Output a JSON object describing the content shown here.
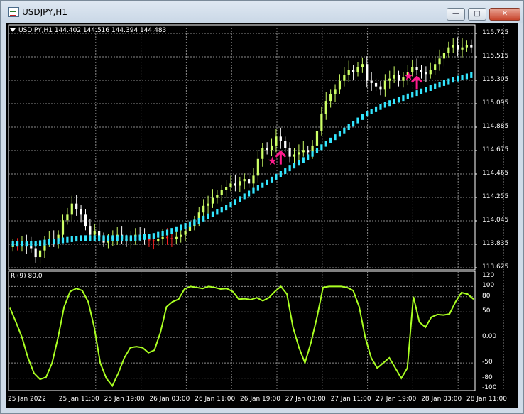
{
  "window": {
    "title": "USDJPY,H1",
    "controls": {
      "minimize": "—",
      "maximize": "□",
      "close": "✕"
    }
  },
  "chart": {
    "symbol_line": "USDJPY,H1  144.402 144.516 144.394 144.483",
    "indicator_label": "RI(9) 80.0",
    "colors": {
      "background": "#000000",
      "grid": "#8a8a8a",
      "bull": "#ccff66",
      "bear": "#ffffff",
      "doji": "#ff2020",
      "ma": "#33e6ff",
      "osc": "#aaff22",
      "signal": "#ff1a8c"
    }
  },
  "chart_data": [
    {
      "type": "candlestick",
      "title": "USDJPY,H1",
      "y_ticks": [
        "115.725",
        "115.515",
        "115.305",
        "115.095",
        "114.885",
        "114.675",
        "114.465",
        "114.255",
        "114.045",
        "113.835",
        "113.625"
      ],
      "ylim": [
        113.625,
        115.725
      ],
      "x_ticks": [
        "25 Jan 2022",
        "25 Jan 11:00",
        "25 Jan 19:00",
        "26 Jan 03:00",
        "26 Jan 11:00",
        "26 Jan 19:00",
        "27 Jan 03:00",
        "27 Jan 11:00",
        "27 Jan 19:00",
        "28 Jan 03:00",
        "28 Jan 11:00"
      ],
      "closes": [
        113.84,
        113.83,
        113.85,
        113.82,
        113.8,
        113.72,
        113.78,
        113.85,
        113.88,
        113.86,
        113.92,
        114.05,
        114.1,
        114.2,
        114.15,
        114.1,
        114.0,
        113.92,
        113.95,
        113.9,
        113.85,
        113.88,
        113.9,
        113.92,
        113.88,
        113.86,
        113.9,
        113.92,
        113.9,
        113.88,
        113.87,
        113.86,
        113.88,
        113.9,
        113.89,
        113.88,
        113.9,
        113.92,
        113.95,
        114.0,
        114.05,
        114.12,
        114.18,
        114.2,
        114.25,
        114.28,
        114.32,
        114.35,
        114.38,
        114.36,
        114.4,
        114.42,
        114.38,
        114.45,
        114.6,
        114.7,
        114.68,
        114.72,
        114.8,
        114.76,
        114.7,
        114.62,
        114.64,
        114.66,
        114.68,
        114.66,
        114.72,
        114.85,
        115.0,
        115.12,
        115.18,
        115.22,
        115.3,
        115.35,
        115.4,
        115.38,
        115.42,
        115.45,
        115.3,
        115.28,
        115.25,
        115.22,
        115.3,
        115.32,
        115.35,
        115.3,
        115.33,
        115.38,
        115.42,
        115.4,
        115.38,
        115.36,
        115.4,
        115.45,
        115.5,
        115.55,
        115.6,
        115.62,
        115.58,
        115.6,
        115.62,
        115.6
      ],
      "ma_values": [
        113.84,
        113.84,
        113.84,
        113.84,
        113.84,
        113.84,
        113.845,
        113.85,
        113.855,
        113.86,
        113.865,
        113.87,
        113.875,
        113.88,
        113.885,
        113.89,
        113.89,
        113.89,
        113.89,
        113.89,
        113.89,
        113.89,
        113.89,
        113.89,
        113.89,
        113.89,
        113.89,
        113.89,
        113.895,
        113.9,
        113.905,
        113.91,
        113.92,
        113.93,
        113.94,
        113.955,
        113.97,
        113.985,
        114.0,
        114.015,
        114.03,
        114.045,
        114.065,
        114.085,
        114.105,
        114.125,
        114.145,
        114.165,
        114.19,
        114.215,
        114.24,
        114.265,
        114.29,
        114.315,
        114.34,
        114.365,
        114.39,
        114.415,
        114.44,
        114.465,
        114.49,
        114.515,
        114.54,
        114.565,
        114.59,
        114.615,
        114.645,
        114.675,
        114.705,
        114.735,
        114.765,
        114.795,
        114.825,
        114.855,
        114.885,
        114.915,
        114.945,
        114.975,
        115.005,
        115.025,
        115.045,
        115.065,
        115.085,
        115.1,
        115.115,
        115.13,
        115.145,
        115.16,
        115.175,
        115.19,
        115.205,
        115.22,
        115.235,
        115.25,
        115.265,
        115.28,
        115.295,
        115.31,
        115.32,
        115.33,
        115.34,
        115.35
      ],
      "signals": [
        {
          "kind": "star",
          "price": 114.58,
          "index": 57
        },
        {
          "kind": "arrow-up",
          "price": 114.55,
          "index": 59
        },
        {
          "kind": "star",
          "price": 115.34,
          "index": 87
        },
        {
          "kind": "arrow-up",
          "price": 115.22,
          "index": 89
        }
      ]
    },
    {
      "type": "line",
      "title": "RI(9) 80.0",
      "y_ticks": [
        "120",
        "100",
        "80",
        "50",
        "0.00",
        "-50",
        "-80",
        "-100"
      ],
      "ylim": [
        -100,
        120
      ],
      "levels": [
        -80,
        -50,
        0,
        50,
        80,
        100
      ],
      "values": [
        58,
        30,
        0,
        -40,
        -70,
        -82,
        -78,
        -50,
        0,
        60,
        90,
        96,
        92,
        70,
        20,
        -50,
        -80,
        -95,
        -70,
        -40,
        -20,
        -18,
        -20,
        -30,
        -25,
        10,
        60,
        70,
        75,
        95,
        100,
        98,
        96,
        100,
        98,
        95,
        96,
        90,
        75,
        76,
        74,
        78,
        72,
        78,
        90,
        100,
        85,
        20,
        -20,
        -50,
        -10,
        40,
        98,
        100,
        100,
        100,
        98,
        92,
        60,
        0,
        -40,
        -60,
        -50,
        -40,
        -60,
        -80,
        -60,
        80,
        30,
        20,
        40,
        45,
        44,
        46,
        70,
        88,
        85,
        75
      ]
    }
  ]
}
